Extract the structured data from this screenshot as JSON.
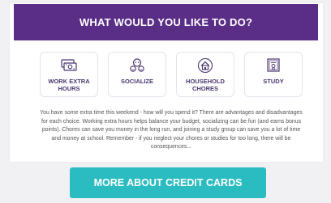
{
  "header": {
    "title": "WHAT WOULD YOU LIKE TO DO?"
  },
  "choices": [
    {
      "label": "WORK EXTRA HOURS",
      "icon": "cash-icon"
    },
    {
      "label": "SOCIALIZE",
      "icon": "people-icon"
    },
    {
      "label": "HOUSEHOLD CHORES",
      "icon": "house-icon"
    },
    {
      "label": "STUDY",
      "icon": "certificate-icon"
    }
  ],
  "description": "You have some extra time this weekend - how will you spend it? There are advantages and disadvantages for each choice. Working extra hours helps balance your budget, socializing can be fun (and earns bonus points). Chores can save you money in the long run, and joining a study group can save you a lot of time and money at school. Remember - if you neglect your chores or studies for too long, there will be consequences...",
  "cta": {
    "label": "MORE ABOUT CREDIT CARDS"
  },
  "colors": {
    "header_bg": "#5a2e86",
    "accent_teal": "#2bbcc1",
    "icon_purple": "#4a3570"
  }
}
